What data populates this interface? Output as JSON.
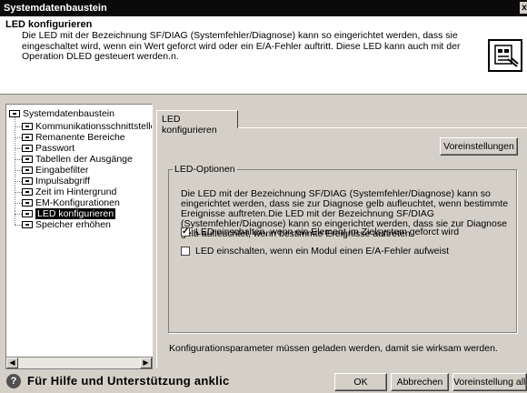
{
  "window": {
    "title": "Systemdatenbaustein",
    "close_glyph": "x"
  },
  "header": {
    "heading": "LED konfigurieren",
    "description": "Die LED mit der Bezeichnung SF/DIAG (Systemfehler/Diagnose) kann so eingerichtet werden, dass sie eingeschaltet wird, wenn ein Wert geforct wird oder ein E/A-Fehler auftritt. Diese LED kann auch mit der Operation DLED gesteuert werden.n.",
    "icon": "module-config-icon"
  },
  "tree": {
    "root": "Systemdatenbaustein",
    "items": [
      {
        "label": "Kommunikationsschnittstelle",
        "selected": false
      },
      {
        "label": "Remanente Bereiche",
        "selected": false
      },
      {
        "label": "Passwort",
        "selected": false
      },
      {
        "label": "Tabellen der Ausgänge",
        "selected": false
      },
      {
        "label": "Eingabefilter",
        "selected": false
      },
      {
        "label": "Impulsabgriff",
        "selected": false
      },
      {
        "label": "Zeit im Hintergrund",
        "selected": false
      },
      {
        "label": "EM-Konfigurationen",
        "selected": false
      },
      {
        "label": "LED konfigurieren",
        "selected": true
      },
      {
        "label": "Speicher erhöhen",
        "selected": false
      }
    ]
  },
  "tab": {
    "label": "LED konfigurieren"
  },
  "buttons": {
    "defaults": "Voreinstellungen",
    "ok": "OK",
    "cancel": "Abbrechen",
    "defaults_all": "Voreinstellung alle"
  },
  "group": {
    "title": "LED-Optionen",
    "text": "Die LED mit der Bezeichnung SF/DIAG (Systemfehler/Diagnose) kann so eingerichtet werden, dass sie zur Diagnose gelb aufleuchtet, wenn bestimmte Ereignisse auftreten.Die LED mit der Bezeichnung SF/DIAG (Systemfehler/Diagnose) kann so eingerichtet werden, dass sie zur Diagnose gelb aufleuchtet, wenn bestimmte Ereignisse auftreten.",
    "options": [
      {
        "label": "LED einschalten, wenn ein Element im Zielsystem geforct wird",
        "checked": true
      },
      {
        "label": "LED einschalten, wenn ein Modul einen E/A-Fehler aufweist",
        "checked": false
      }
    ]
  },
  "footnote": "Konfigurationsparameter müssen geladen werden, damit sie wirksam werden.",
  "help": {
    "icon_glyph": "?",
    "text": "Für Hilfe und Unterstützung anklic"
  }
}
